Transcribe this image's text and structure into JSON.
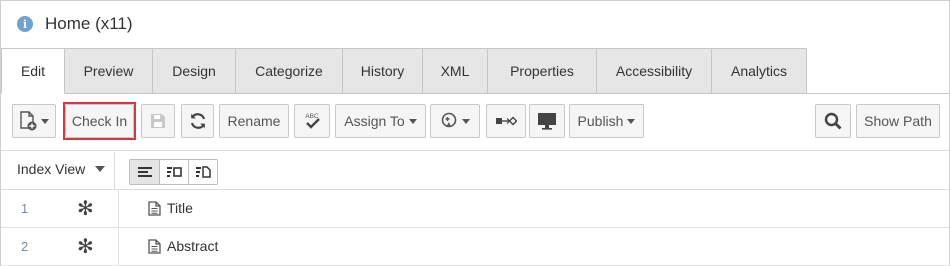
{
  "header": {
    "title": "Home (x11)"
  },
  "tabs": [
    {
      "label": "Edit"
    },
    {
      "label": "Preview"
    },
    {
      "label": "Design"
    },
    {
      "label": "Categorize"
    },
    {
      "label": "History"
    },
    {
      "label": "XML"
    },
    {
      "label": "Properties"
    },
    {
      "label": "Accessibility"
    },
    {
      "label": "Analytics"
    }
  ],
  "toolbar": {
    "check_in": "Check In",
    "rename": "Rename",
    "assign_to": "Assign To",
    "publish": "Publish",
    "show_path": "Show Path",
    "spellcheck_abc": "ABC"
  },
  "index": {
    "view_label": "Index View",
    "rows": [
      {
        "number": "1",
        "label": "Title"
      },
      {
        "number": "2",
        "label": "Abstract"
      }
    ]
  },
  "colors": {
    "highlight": "#d9363e",
    "info": "#6fa1d3",
    "tab_bg": "#e6e6e6"
  }
}
